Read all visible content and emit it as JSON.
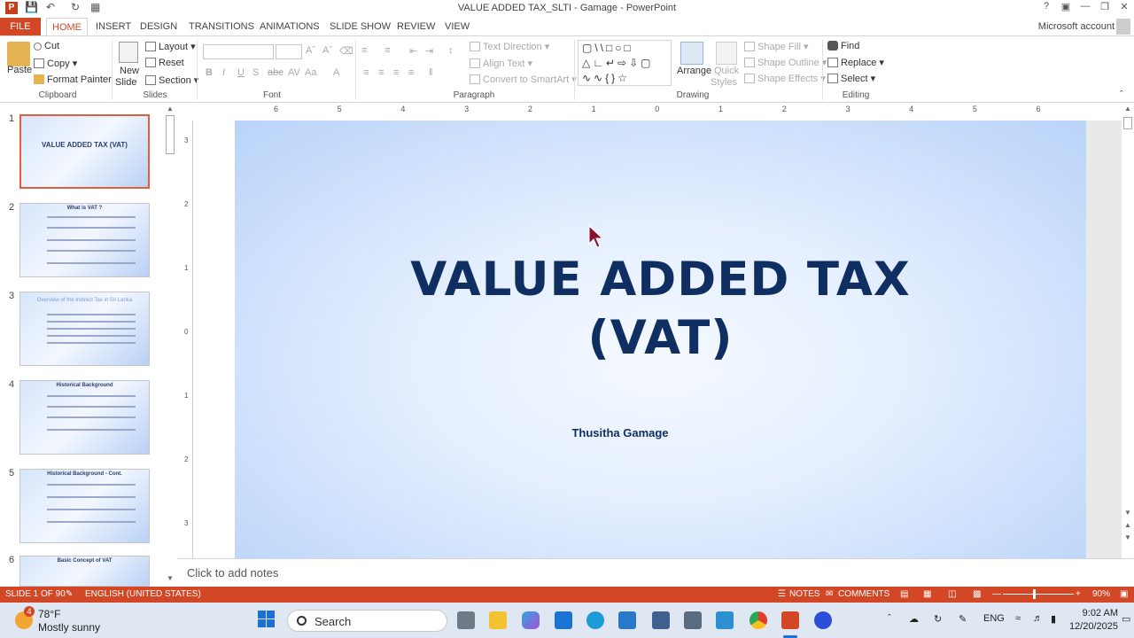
{
  "window": {
    "title": "VALUE ADDED TAX_SLTI - Gamage - PowerPoint",
    "account": "Microsoft account",
    "help": "?"
  },
  "tabs": [
    "FILE",
    "HOME",
    "INSERT",
    "DESIGN",
    "TRANSITIONS",
    "ANIMATIONS",
    "SLIDE SHOW",
    "REVIEW",
    "VIEW"
  ],
  "ribbon": {
    "clipboard": {
      "label": "Clipboard",
      "paste": "Paste",
      "cut": "Cut",
      "copy": "Copy",
      "format_painter": "Format Painter"
    },
    "slides": {
      "label": "Slides",
      "new_slide": "New",
      "new_slide2": "Slide",
      "layout": "Layout",
      "reset": "Reset",
      "section": "Section"
    },
    "font": {
      "label": "Font"
    },
    "paragraph": {
      "label": "Paragraph",
      "text_direction": "Text Direction",
      "align_text": "Align Text",
      "smartart": "Convert to SmartArt"
    },
    "drawing": {
      "label": "Drawing",
      "arrange": "Arrange",
      "quick_styles": "Quick",
      "quick_styles2": "Styles",
      "shape_fill": "Shape Fill",
      "shape_outline": "Shape Outline",
      "shape_effects": "Shape Effects"
    },
    "editing": {
      "label": "Editing",
      "find": "Find",
      "replace": "Replace",
      "select": "Select"
    }
  },
  "ruler": {
    "h_ticks": [
      "6",
      "5",
      "4",
      "3",
      "2",
      "1",
      "0",
      "1",
      "2",
      "3",
      "4",
      "5",
      "6"
    ],
    "v_ticks": [
      "3",
      "2",
      "1",
      "0",
      "1",
      "2",
      "3"
    ]
  },
  "thumbnails": [
    {
      "num": "1",
      "title": "VALUE ADDED TAX (VAT)",
      "selected": true
    },
    {
      "num": "2",
      "title": "What is VAT ?"
    },
    {
      "num": "3",
      "title": "Overview of the Indirect Tax in Sri Lanka"
    },
    {
      "num": "4",
      "title": "Historical Background"
    },
    {
      "num": "5",
      "title": "Historical Background - Cont."
    },
    {
      "num": "6",
      "title": "Basic Concept of VAT"
    }
  ],
  "slide": {
    "title_line1": "VALUE ADDED TAX",
    "title_line2": "(VAT)",
    "author": "Thusitha Gamage"
  },
  "notes": {
    "placeholder": "Click to add notes"
  },
  "status": {
    "slide": "SLIDE 1 OF 90",
    "language": "ENGLISH (UNITED STATES)",
    "notes": "NOTES",
    "comments": "COMMENTS",
    "zoom": "90%"
  },
  "taskbar": {
    "temp": "78°F",
    "weather": "Mostly sunny",
    "badge": "4",
    "search": "Search",
    "lang": "ENG",
    "time": "9:02 AM",
    "date": "12/20/2025"
  }
}
